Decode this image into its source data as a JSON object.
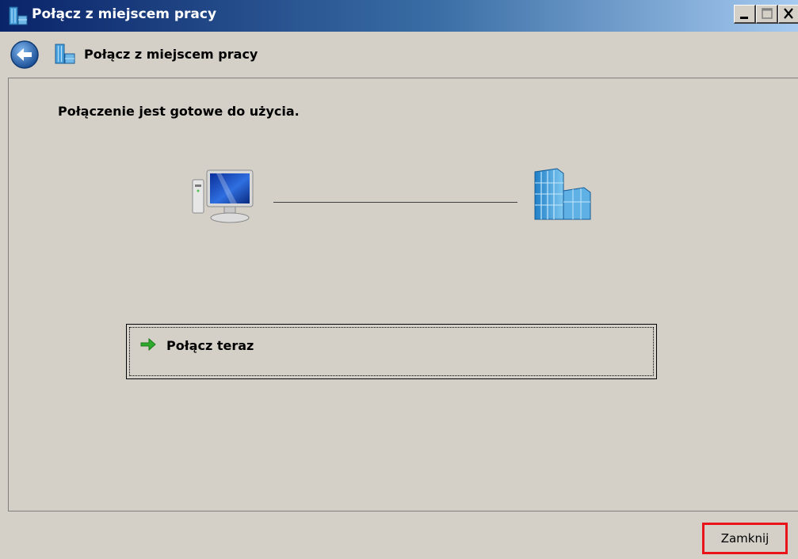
{
  "window": {
    "title": "Połącz z miejscem pracy",
    "icon": "workplace-network-icon",
    "controls": [
      "minimize-icon",
      "maximize-icon",
      "close-icon"
    ]
  },
  "header": {
    "back_icon": "back-arrow-icon",
    "icon": "workplace-network-icon",
    "title": "Połącz z miejscem pracy"
  },
  "main": {
    "status": "Połączenie jest gotowe do użycia.",
    "diagram": {
      "left_icon": "computer-icon",
      "right_icon": "office-building-icon"
    },
    "connect_option": {
      "icon": "green-arrow-icon",
      "label": "Połącz teraz"
    }
  },
  "footer": {
    "close_label": "Zamknij"
  },
  "colors": {
    "titlebar_start": "#0a246a",
    "titlebar_end": "#a6caf0",
    "dialog_bg": "#d4d0c8",
    "highlight_border": "#e8141a",
    "accent_arrow": "#2eaa2e"
  }
}
